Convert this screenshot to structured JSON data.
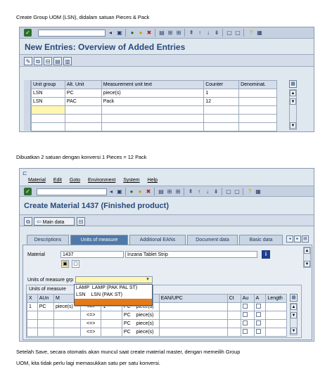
{
  "captions": {
    "top": "Create Group UOM (LSN), didalam satuan Pieces & Pack",
    "middle": "Dibuatkan 2 satuan dengan konversi 1 Pieces = 12 Pack",
    "bottom_line1": "Setelah Save, secara otomatis akan muncul saat create material master, dengan memeilih Group",
    "bottom_line2": "UOM, kita tidak perlu lagi memasukkan satu per satu konversi."
  },
  "screen1": {
    "title": "New Entries: Overview of Added Entries",
    "columns": [
      "Unit group",
      "Alt. Unit",
      "Measurement unit text",
      "Counter",
      "Denominat."
    ],
    "rows": [
      [
        "LSN",
        "PC",
        "piece(s)",
        "1",
        ""
      ],
      [
        "LSN",
        "PAC",
        "Pack",
        "12",
        ""
      ],
      [
        "",
        "",
        "",
        "",
        ""
      ],
      [
        "",
        "",
        "",
        "",
        ""
      ],
      [
        "",
        "",
        "",
        "",
        ""
      ]
    ]
  },
  "screen2": {
    "menu": [
      "Material",
      "Edit",
      "Goto",
      "Environment",
      "System",
      "Help"
    ],
    "title": "Create Material 1437 (Finished product)",
    "main_data_label": "Main data",
    "tabs": [
      "Descriptions",
      "Units of measure",
      "Additional EANs",
      "Document data",
      "Basic data"
    ],
    "active_tab": "Units of measure",
    "material_label": "Material",
    "material_number": "1437",
    "material_description": "Inzana Tablet Strip",
    "uom_group_label": "Units of measure grp",
    "uom_section_label": "Units of measure",
    "dropdown_options": [
      "LAMP  LAMP (PAK PAL ST)",
      "LSN    LSN (PAK ST)",
      ""
    ],
    "uom_columns": [
      "X",
      "AUn",
      "M",
      "",
      "",
      "ur",
      "EAN/UPC",
      "Ct",
      "Au",
      "A",
      "Length"
    ],
    "uom_rows": [
      [
        "1",
        "PC",
        "piece(s)",
        "<=>",
        "1",
        "PC",
        "piece(s)"
      ],
      [
        "",
        "",
        "",
        "<=>",
        "",
        "PC",
        "piece(s)"
      ],
      [
        "",
        "",
        "",
        "<=>",
        "",
        "PC",
        "piece(s)"
      ],
      [
        "",
        "",
        "",
        "<=>",
        "",
        "PC",
        "piece(s)"
      ]
    ]
  }
}
